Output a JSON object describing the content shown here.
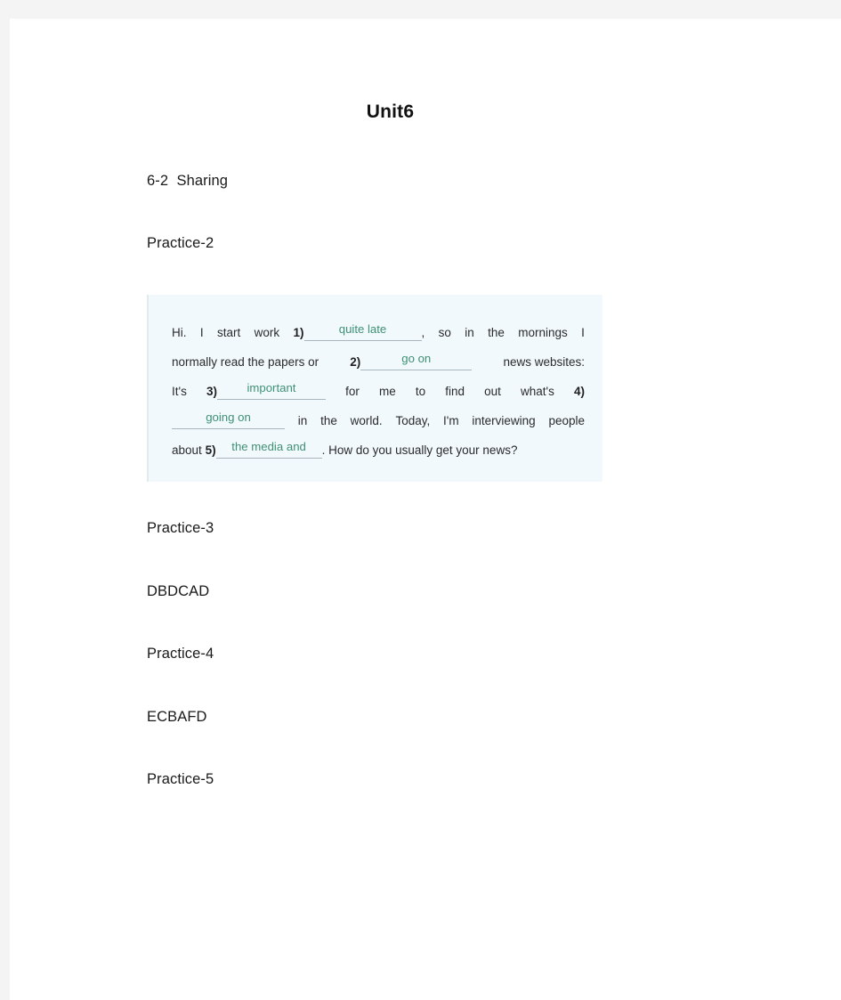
{
  "document": {
    "title": "Unit6",
    "sections": [
      {
        "name": "section-heading",
        "text": "6-2  Sharing"
      },
      {
        "name": "practice-2-heading",
        "text": "Practice-2"
      },
      {
        "name": "practice-3-heading",
        "text": "Practice-3"
      },
      {
        "name": "practice-3-answer",
        "text": "DBDCAD"
      },
      {
        "name": "practice-4-heading",
        "text": "Practice-4"
      },
      {
        "name": "practice-4-answer",
        "text": "ECBAFD"
      },
      {
        "name": "practice-5-heading",
        "text": "Practice-5"
      }
    ]
  },
  "quote_box": {
    "background_color": "#f1f9fd",
    "answer_color": "#3f9173",
    "line1": {
      "a": "Hi.",
      "b": "I",
      "c": "start",
      "d": "work",
      "num": "1)",
      "answer": "quite late",
      "e": ",",
      "f": "so",
      "g": "in",
      "h": "the",
      "i": "mornings",
      "j": "I"
    },
    "line2": {
      "a": "normally read the papers or",
      "num": "2)",
      "answer": "go on",
      "b": "news websites:"
    },
    "line3": {
      "a": "It's",
      "num": "3)",
      "answer": "important",
      "b": "for",
      "c": "me",
      "d": "to",
      "e": "find",
      "f": "out",
      "g": "what's",
      "h": "4)"
    },
    "line4": {
      "answer": "going on",
      "a": "in",
      "b": "the",
      "c": "world.",
      "d": "Today,",
      "e": "I'm",
      "f": "interviewing",
      "g": "people"
    },
    "line5": {
      "a": "about",
      "num": "5)",
      "answer": "the media and",
      "b": ". How do you usually get your news?"
    }
  }
}
